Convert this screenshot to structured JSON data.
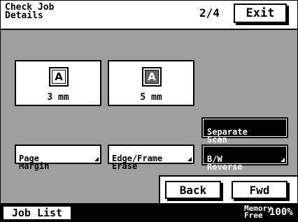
{
  "header": {
    "title": "Check Job\nDetails",
    "page_indicator": "2/4",
    "exit_label": "Exit"
  },
  "settings": {
    "page_margin": {
      "icon_letter": "A",
      "value": "3 mm",
      "button_label": "Page\nMargin"
    },
    "edge_frame_erase": {
      "icon_letter": "A",
      "value": "5 mm",
      "button_label": "Edge/Frame\nErase"
    },
    "separate_scan_label": "Separate\nScan",
    "bw_reverse_label": "B/W\nReverse"
  },
  "nav": {
    "back_label": "Back",
    "fwd_label": "Fwd"
  },
  "footer": {
    "job_list_label": "Job List",
    "memory_label": "Memory\nFree",
    "memory_value": "100%"
  }
}
